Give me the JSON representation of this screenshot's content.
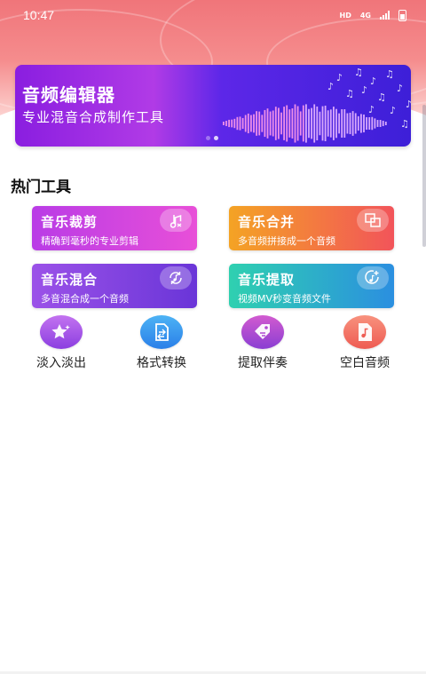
{
  "status_bar": {
    "time": "10:47",
    "hd": "HD",
    "network": "4G"
  },
  "banner": {
    "title": "音频编辑器",
    "subtitle": "专业混音合成制作工具",
    "slide_count": 2,
    "active_slide": 2
  },
  "hot_tools": {
    "title": "热门工具",
    "cards": [
      {
        "title": "音乐裁剪",
        "desc": "精确到毫秒的专业剪辑",
        "icon": "music-note-scissors-icon"
      },
      {
        "title": "音乐合并",
        "desc": "多音频拼接成一个音频",
        "icon": "merge-squares-icon"
      },
      {
        "title": "音乐混合",
        "desc": "多音混合成一个音频",
        "icon": "music-cycle-icon"
      },
      {
        "title": "音乐提取",
        "desc": "视频MV秒变音频文件",
        "icon": "music-extract-icon"
      }
    ]
  },
  "shortcuts": [
    {
      "label": "淡入淡出",
      "icon": "star-sparkle-icon",
      "color": "#a24fe6"
    },
    {
      "label": "格式转换",
      "icon": "file-convert-icon",
      "color": "#3a98ef"
    },
    {
      "label": "提取伴奏",
      "icon": "tag-icon",
      "color": "#b04ad2"
    },
    {
      "label": "空白音频",
      "icon": "music-file-icon",
      "color": "#f3705f"
    }
  ],
  "colors": {
    "header_red": "#f0757a",
    "banner_purple": "#8a1ee0"
  }
}
